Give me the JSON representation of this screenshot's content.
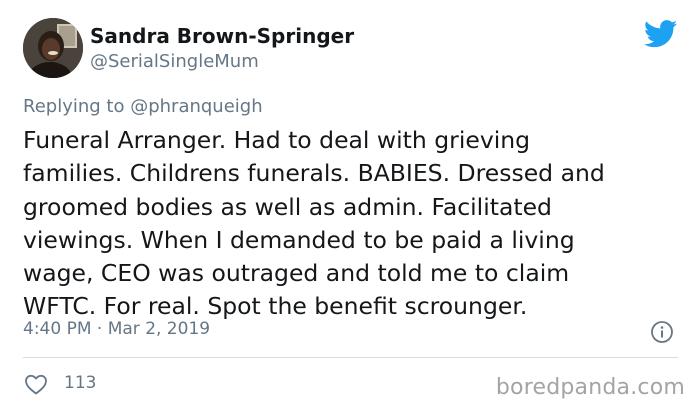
{
  "user": {
    "display_name": "Sandra Brown-Springer",
    "handle": "@SerialSingleMum"
  },
  "reply": {
    "prefix": "Replying to ",
    "handle": "@phranqueigh"
  },
  "tweet": {
    "text_lines": [
      "Funeral Arranger. Had to deal with grieving",
      "families. Childrens funerals. BABIES. Dressed and",
      "groomed bodies as well as admin. Facilitated",
      "viewings. When I demanded to be paid a living",
      "wage, CEO was outraged and told me to claim",
      "WFTC. For real. Spot the benefit scrounger."
    ],
    "timestamp": "4:40 PM · Mar 2, 2019"
  },
  "stats": {
    "likes": "113"
  },
  "icons": {
    "logo": "twitter-bird-icon",
    "info": "info-icon",
    "like": "heart-icon"
  },
  "colors": {
    "twitter_blue": "#1da1f2",
    "secondary_text": "#657786",
    "primary_text": "#14171a",
    "divider": "#d5dde3"
  },
  "watermark": "boredpanda.com"
}
